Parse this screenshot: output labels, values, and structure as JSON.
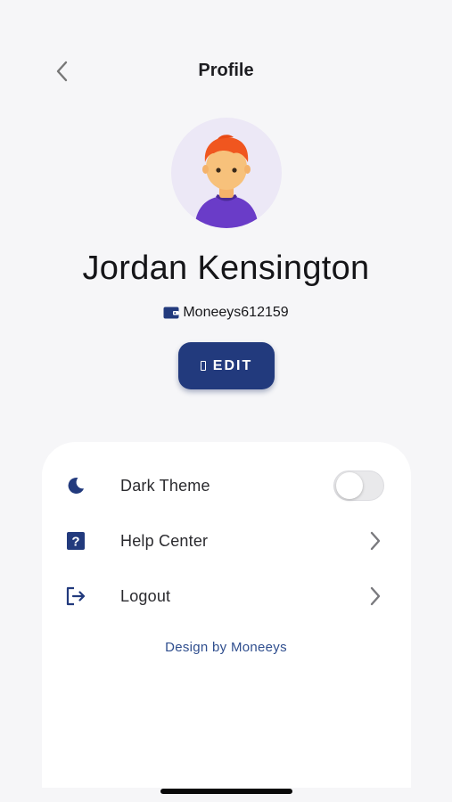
{
  "header": {
    "title": "Profile",
    "back_icon": "chevron-left-icon"
  },
  "profile": {
    "avatar_icon": "person-avatar-icon",
    "name": "Jordan Kensington",
    "wallet_icon": "wallet-icon",
    "wallet_id": "Moneeys612159",
    "edit_label": "EDIT",
    "edit_icon": "edit-icon"
  },
  "settings": {
    "items": [
      {
        "label": "Dark Theme",
        "icon": "moon-icon",
        "control": "toggle",
        "toggled": false
      },
      {
        "label": "Help Center",
        "icon": "help-icon",
        "control": "chevron"
      },
      {
        "label": "Logout",
        "icon": "logout-icon",
        "control": "chevron"
      }
    ]
  },
  "footer": {
    "credit": "Design by Moneeys"
  },
  "colors": {
    "primary": "#223a7d",
    "background": "#f6f6f8",
    "card": "#ffffff",
    "credit_text": "#2f4e8e"
  }
}
